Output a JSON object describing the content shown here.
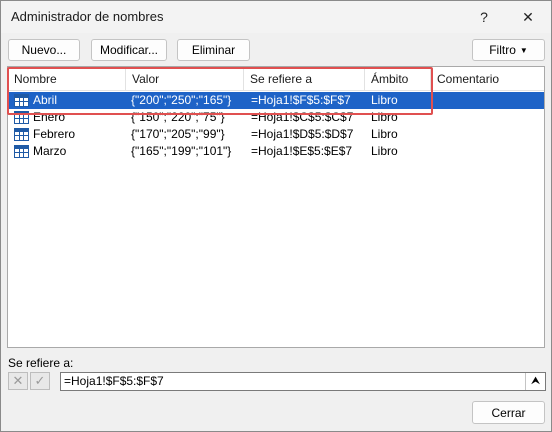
{
  "window": {
    "title": "Administrador de nombres",
    "help": "?",
    "close": "✕"
  },
  "toolbar": {
    "new_label": "Nuevo...",
    "edit_label": "Modificar...",
    "delete_label": "Eliminar",
    "filter_label": "Filtro"
  },
  "table": {
    "columns": [
      "Nombre",
      "Valor",
      "Se refiere a",
      "Ámbito",
      "Comentario"
    ],
    "rows": [
      {
        "name": "Abril",
        "value": "{\"200\";\"250\";\"165\"}",
        "refers": "=Hoja1!$F$5:$F$7",
        "scope": "Libro",
        "comment": "",
        "selected": true
      },
      {
        "name": "Enero",
        "value": "{\"150\";\"220\";\"75\"}",
        "refers": "=Hoja1!$C$5:$C$7",
        "scope": "Libro",
        "comment": "",
        "selected": false
      },
      {
        "name": "Febrero",
        "value": "{\"170\";\"205\";\"99\"}",
        "refers": "=Hoja1!$D$5:$D$7",
        "scope": "Libro",
        "comment": "",
        "selected": false
      },
      {
        "name": "Marzo",
        "value": "{\"165\";\"199\";\"101\"}",
        "refers": "=Hoja1!$E$5:$E$7",
        "scope": "Libro",
        "comment": "",
        "selected": false
      }
    ]
  },
  "refers_section": {
    "label": "Se refiere a:",
    "value": "=Hoja1!$F$5:$F$7"
  },
  "footer": {
    "close_label": "Cerrar"
  },
  "colors": {
    "selection": "#1e63c7",
    "highlight": "#e05050",
    "icon": "#1f5aa6"
  }
}
